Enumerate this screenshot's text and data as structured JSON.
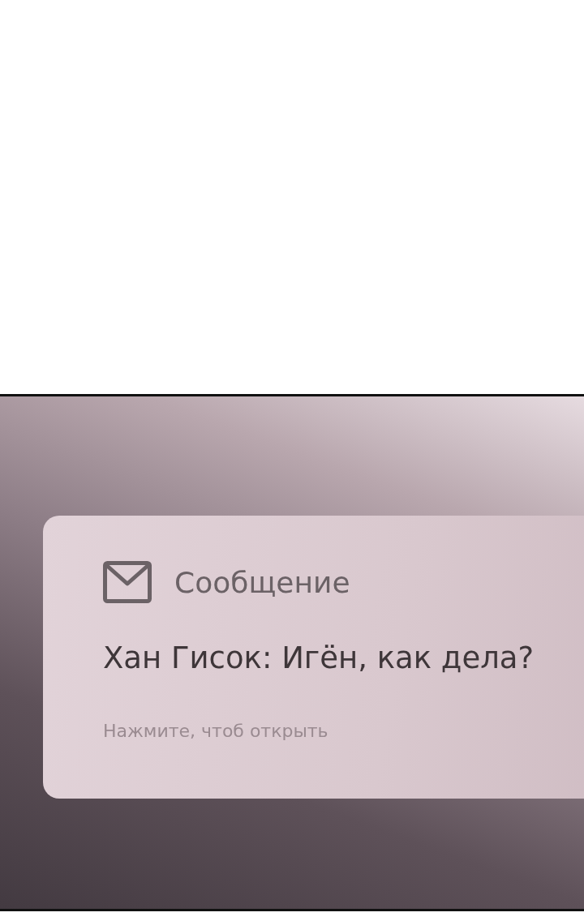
{
  "notification": {
    "app": "Сообщение",
    "message": "Хан Гисок: Игён, как дела?",
    "hint": "Нажмите, чтоб открыть"
  }
}
